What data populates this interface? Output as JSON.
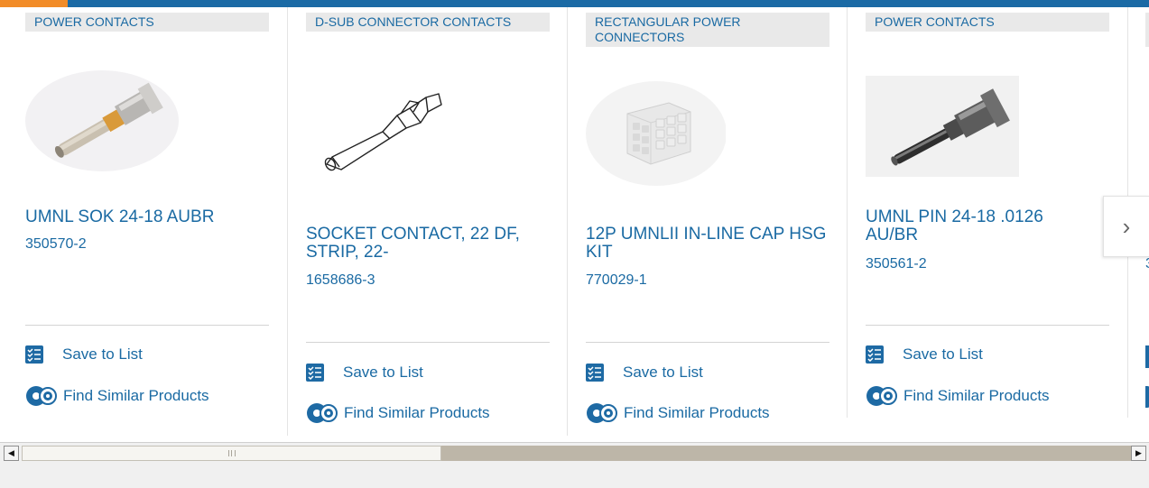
{
  "cards": [
    {
      "category": "POWER CONTACTS",
      "title": "UMNL SOK 24-18 AUBR",
      "part_number": "350570-2",
      "save_label": "Save to List",
      "similar_label": "Find Similar Products",
      "image": "socket-contact-photo"
    },
    {
      "category": "D-SUB CONNECTOR CONTACTS",
      "title": "SOCKET CONTACT, 22 DF, STRIP, 22-",
      "part_number": "1658686-3",
      "save_label": "Save to List",
      "similar_label": "Find Similar Products",
      "image": "d-sub-contact-line-drawing"
    },
    {
      "category": "RECTANGULAR POWER CONNECTORS",
      "title": "12P UMNLII IN-LINE CAP HSG KIT",
      "part_number": "770029-1",
      "save_label": "Save to List",
      "similar_label": "Find Similar Products",
      "image": "housing-kit-photo"
    },
    {
      "category": "POWER CONTACTS",
      "title": "UMNL PIN 24-18 .0126 AU/BR",
      "part_number": "350561-2",
      "save_label": "Save to List",
      "similar_label": "Find Similar Products",
      "image": "pin-contact-photo"
    },
    {
      "category": "",
      "title": "",
      "part_number": "3",
      "save_label": "",
      "similar_label": "",
      "image": "partial-card"
    }
  ],
  "carousel": {
    "next_icon": "chevron-right-icon",
    "next_glyph": "›"
  },
  "scrollbar": {
    "left_arrow": "◀",
    "right_arrow": "▶",
    "position_fraction": 0.0
  },
  "colors": {
    "brand_blue": "#1a6aa3",
    "accent_orange": "#f28c28",
    "category_bg": "#e9e9e9"
  }
}
